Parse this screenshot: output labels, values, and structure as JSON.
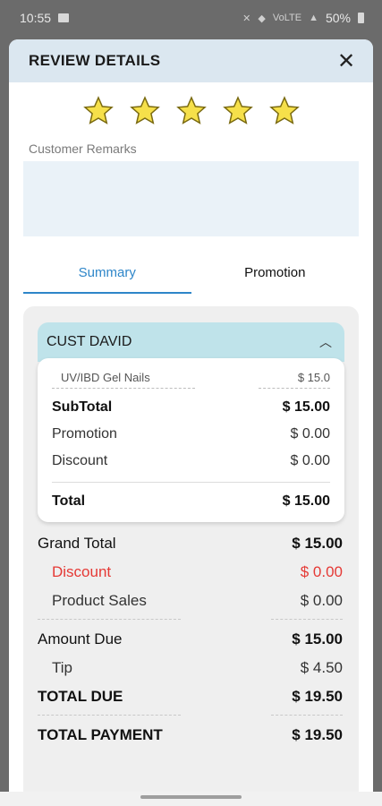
{
  "status_bar": {
    "time": "10:55",
    "battery": "50%",
    "network": "VoLTE"
  },
  "modal": {
    "title": "REVIEW DETAILS",
    "close_glyph": "✕"
  },
  "rating": {
    "value": 5,
    "max": 5,
    "star_color": "#f6e04a"
  },
  "remarks": {
    "label": "Customer Remarks",
    "value": ""
  },
  "tabs": [
    {
      "label": "Summary",
      "active": true
    },
    {
      "label": "Promotion",
      "active": false
    }
  ],
  "customer": {
    "name": "CUST DAVID",
    "service": {
      "name": "UV/IBD Gel Nails",
      "price": "$ 15.0"
    },
    "subtotal": {
      "label": "SubTotal",
      "value": "$ 15.00"
    },
    "promotion": {
      "label": "Promotion",
      "value": "$ 0.00"
    },
    "discount": {
      "label": "Discount",
      "value": "$ 0.00"
    },
    "total": {
      "label": "Total",
      "value": "$ 15.00"
    }
  },
  "totals": {
    "grand_total": {
      "label": "Grand Total",
      "value": "$ 15.00"
    },
    "discount": {
      "label": "Discount",
      "value": "$ 0.00"
    },
    "product_sales": {
      "label": "Product Sales",
      "value": "$ 0.00"
    },
    "amount_due": {
      "label": "Amount Due",
      "value": "$ 15.00"
    },
    "tip": {
      "label": "Tip",
      "value": "$ 4.50"
    },
    "total_due": {
      "label": "TOTAL DUE",
      "value": "$ 19.50"
    },
    "total_payment": {
      "label": "TOTAL PAYMENT",
      "value": "$ 19.50"
    }
  },
  "colors": {
    "accent": "#2e86c9",
    "header_bg": "#dbe7f0",
    "customer_header_bg": "#bfe3ea",
    "discount_red": "#e53935"
  }
}
